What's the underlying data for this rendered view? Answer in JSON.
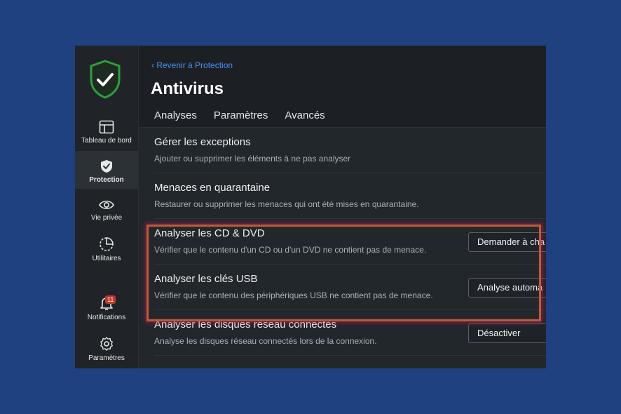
{
  "sidebar": {
    "items": [
      {
        "label": "Tableau de bord",
        "icon": "dashboard-icon"
      },
      {
        "label": "Protection",
        "icon": "shield-icon"
      },
      {
        "label": "Vie privée",
        "icon": "eye-icon"
      },
      {
        "label": "Utilitaires",
        "icon": "utilities-icon"
      },
      {
        "label": "Notifications",
        "icon": "bell-icon",
        "badge": "11"
      },
      {
        "label": "Paramètres",
        "icon": "gear-icon"
      }
    ]
  },
  "header": {
    "back_link": "Revenir à Protection",
    "title": "Antivirus"
  },
  "tabs": [
    {
      "label": "Analyses"
    },
    {
      "label": "Paramètres",
      "active": true
    },
    {
      "label": "Avancés"
    }
  ],
  "settings": [
    {
      "title": "Gérer les exceptions",
      "description": "Ajouter ou supprimer les éléments à ne pas analyser"
    },
    {
      "title": "Menaces en quarantaine",
      "description": "Restaurer ou supprimer les menaces qui ont été mises en quarantaine."
    },
    {
      "title": "Analyser les CD & DVD",
      "description": "Vérifier que le contenu d'un CD ou d'un DVD ne contient pas de menace.",
      "value": "Demander à cha"
    },
    {
      "title": "Analyser les clés USB",
      "description": "Vérifier que le contenu des périphériques USB ne contient pas de menace.",
      "value": "Analyse automa"
    },
    {
      "title": "Analyser les disques réseau connectés",
      "description": "Analyse les disques réseau connectés lors de la connexion.",
      "value": "Désactiver"
    }
  ],
  "colors": {
    "background": "#1f4180",
    "accent": "#4a8ff0",
    "logo_green": "#2e9e3e",
    "highlight_border": "#b85c3a"
  }
}
